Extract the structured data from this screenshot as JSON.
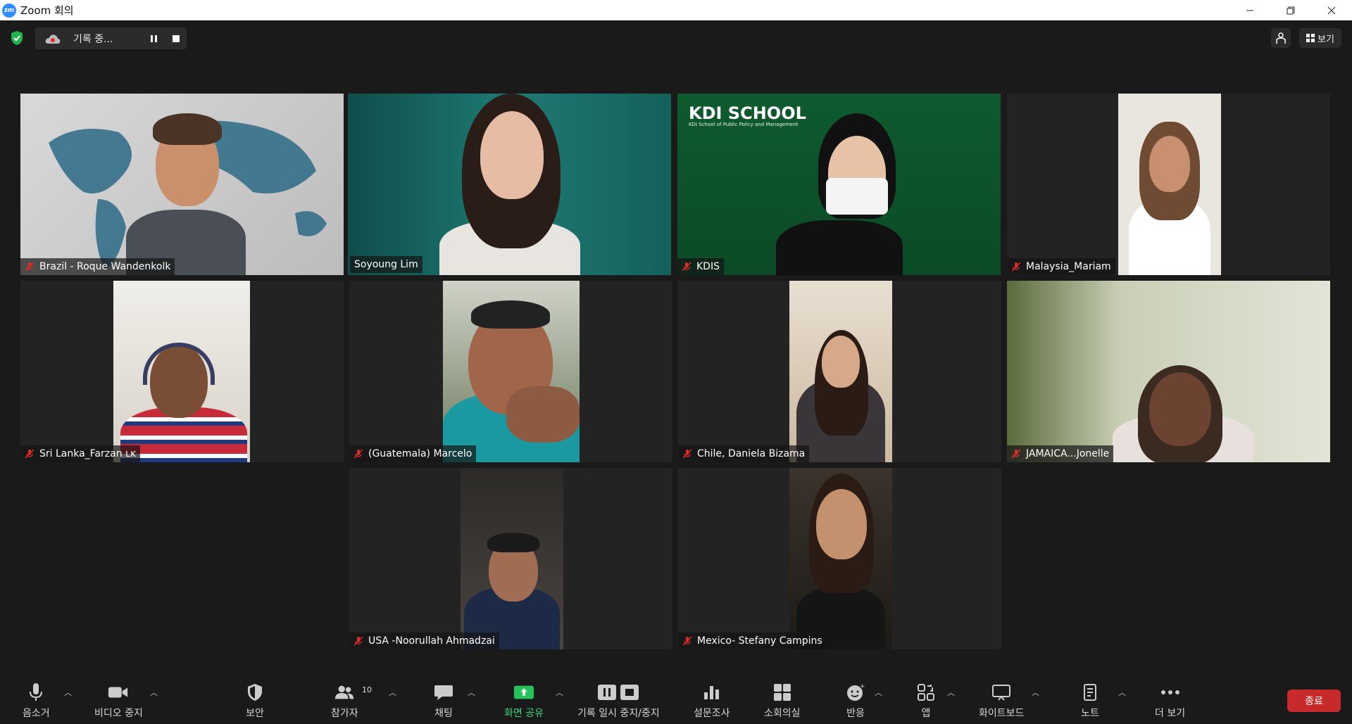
{
  "window": {
    "title": "Zoom 회의",
    "logo_text": "zm"
  },
  "recording": {
    "label": "기록 중..."
  },
  "top_right": {
    "view_label": "보기"
  },
  "participants": [
    {
      "name": "Brazil - Roque Wandenkolk",
      "muted": true
    },
    {
      "name": "Soyoung Lim",
      "muted": false,
      "active_speaker": true
    },
    {
      "name": "KDIS",
      "muted": true
    },
    {
      "name": "Malaysia_Mariam",
      "muted": true
    },
    {
      "name": "Sri Lanka_Farzan ʟᴋ",
      "muted": true
    },
    {
      "name": "(Guatemala) Marcelo",
      "muted": true
    },
    {
      "name": "Chile, Daniela Bizama",
      "muted": true
    },
    {
      "name": "JAMAICA...Jonelle",
      "muted": true
    },
    {
      "name": "USA -Noorullah Ahmadzai",
      "muted": true
    },
    {
      "name": "Mexico- Stefany Campins",
      "muted": true
    }
  ],
  "kdis_banner": {
    "title": "KDI SCHOOL",
    "subtitle": "KDI School of Public Policy and Management"
  },
  "toolbar": {
    "mute": "음소거",
    "video": "비디오 중지",
    "security": "보안",
    "participants": "참가자",
    "participants_count": "10",
    "chat": "채팅",
    "share": "화면 공유",
    "record": "기록 일시 중지/중지",
    "polls": "설문조사",
    "breakout": "소회의실",
    "reactions": "반응",
    "apps": "앱",
    "whiteboard": "화이트보드",
    "notes": "노트",
    "more": "더 보기",
    "end": "종료"
  },
  "colors": {
    "accent_green": "#3fd77c",
    "end_red": "#c72a2a",
    "speaker_outline": "#d7ec7a",
    "zoom_blue": "#2d8cff"
  }
}
